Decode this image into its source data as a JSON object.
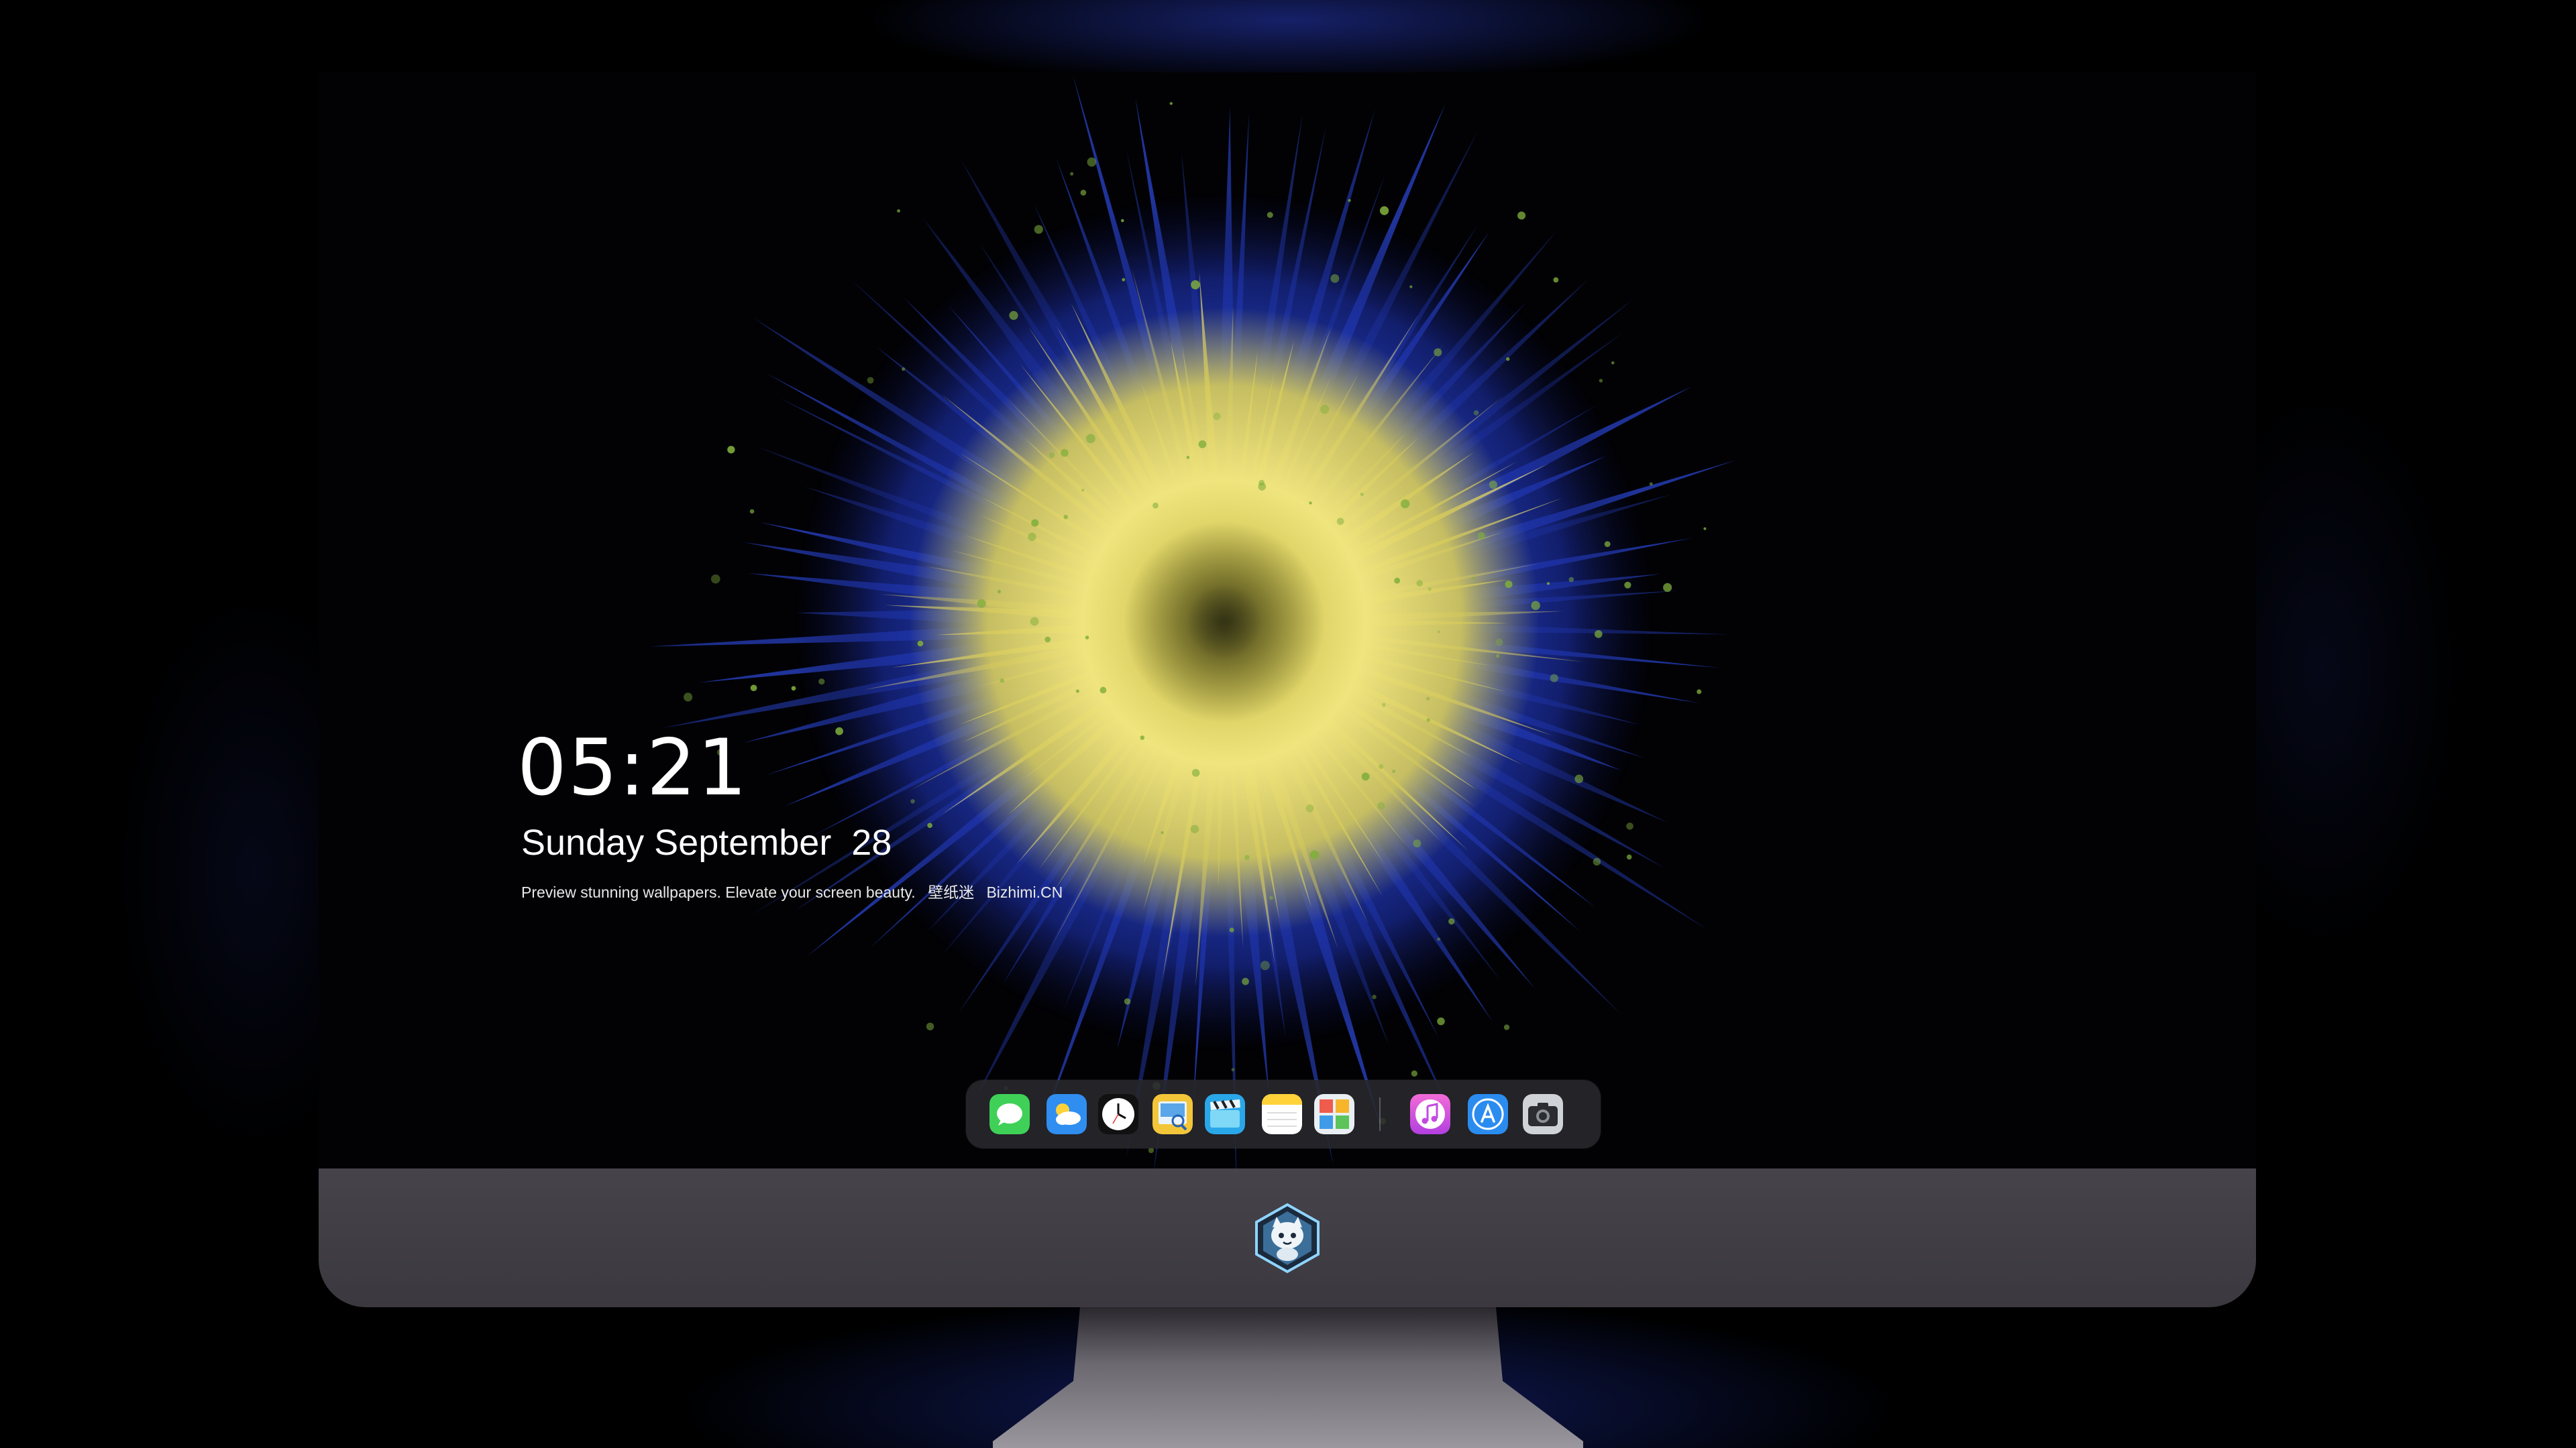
{
  "lockscreen": {
    "time": "05:21",
    "date_weekday_month": "Sunday September",
    "date_day": "28",
    "tagline_text": "Preview stunning wallpapers. Elevate your screen beauty.",
    "tagline_brand_cn": "壁纸迷",
    "tagline_brand": "Bizhimi.CN"
  },
  "dock": {
    "apps": [
      {
        "icon": "messages-icon"
      },
      {
        "icon": "weather-icon"
      },
      {
        "icon": "clock-icon"
      },
      {
        "icon": "preview-icon"
      },
      {
        "icon": "clips-icon"
      },
      {
        "icon": "notes-icon"
      },
      {
        "icon": "photo-booth-icon"
      },
      {
        "icon": "music-icon"
      },
      {
        "icon": "app-store-icon"
      },
      {
        "icon": "camera-icon"
      }
    ]
  },
  "monitor": {
    "chin_logo": "mascot-logo-icon"
  },
  "colors": {
    "wallpaper_yellow": "#e8dc6a",
    "wallpaper_blue": "#1f3fc8",
    "chin": "#423f46",
    "background": "#000000"
  }
}
